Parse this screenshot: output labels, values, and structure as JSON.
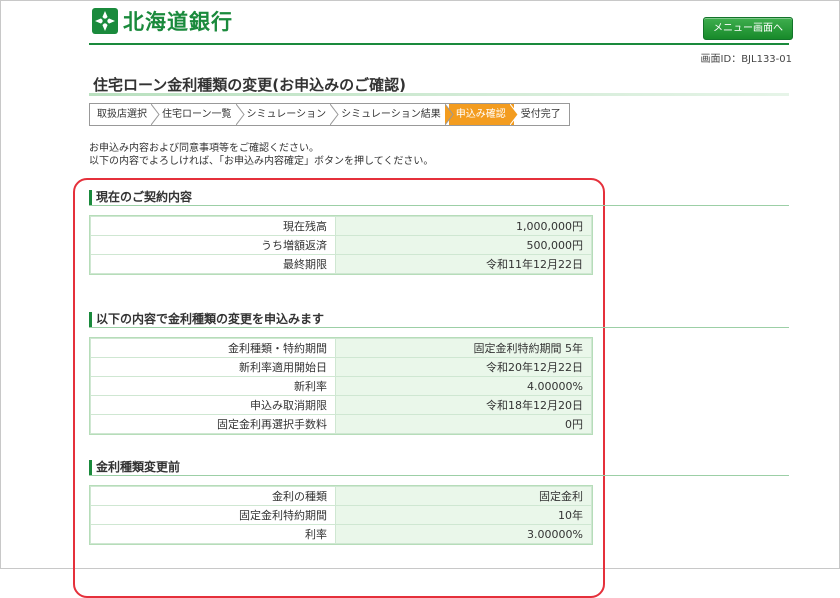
{
  "header": {
    "bank_name": "北海道銀行",
    "menu_button_label": "メニュー画面へ",
    "screen_id": "画面ID：BJL133-01"
  },
  "page": {
    "title": "住宅ローン金利種類の変更(お申込みのご確認)"
  },
  "steps": [
    {
      "label": "取扱店選択",
      "active": false
    },
    {
      "label": "住宅ローン一覧",
      "active": false
    },
    {
      "label": "シミュレーション",
      "active": false
    },
    {
      "label": "シミュレーション結果",
      "active": false
    },
    {
      "label": "申込み確認",
      "active": true
    },
    {
      "label": "受付完了",
      "active": false
    }
  ],
  "intro": {
    "line1": "お申込み内容および同意事項等をご確認ください。",
    "line2": "以下の内容でよろしければ、「お申込み内容確定」ボタンを押してください。"
  },
  "sections": [
    {
      "heading": "現在のご契約内容",
      "rows": [
        {
          "label": "現在残高",
          "value": "1,000,000円"
        },
        {
          "label": "うち増額返済",
          "value": "500,000円"
        },
        {
          "label": "最終期限",
          "value": "令和11年12月22日"
        }
      ]
    },
    {
      "heading": "以下の内容で金利種類の変更を申込みます",
      "rows": [
        {
          "label": "金利種類・特約期間",
          "value": "固定金利特約期間 5年"
        },
        {
          "label": "新利率適用開始日",
          "value": "令和20年12月22日"
        },
        {
          "label": "新利率",
          "value": "4.00000%"
        },
        {
          "label": "申込み取消期限",
          "value": "令和18年12月20日"
        },
        {
          "label": "固定金利再選択手数料",
          "value": "0円"
        }
      ]
    },
    {
      "heading": "金利種類変更前",
      "rows": [
        {
          "label": "金利の種類",
          "value": "固定金利"
        },
        {
          "label": "固定金利特約期間",
          "value": "10年"
        },
        {
          "label": "利率",
          "value": "3.00000%"
        }
      ]
    }
  ],
  "colors": {
    "brand_green": "#1a8a3c",
    "active_step": "#f39c1f",
    "highlight_red": "#e5303b"
  }
}
